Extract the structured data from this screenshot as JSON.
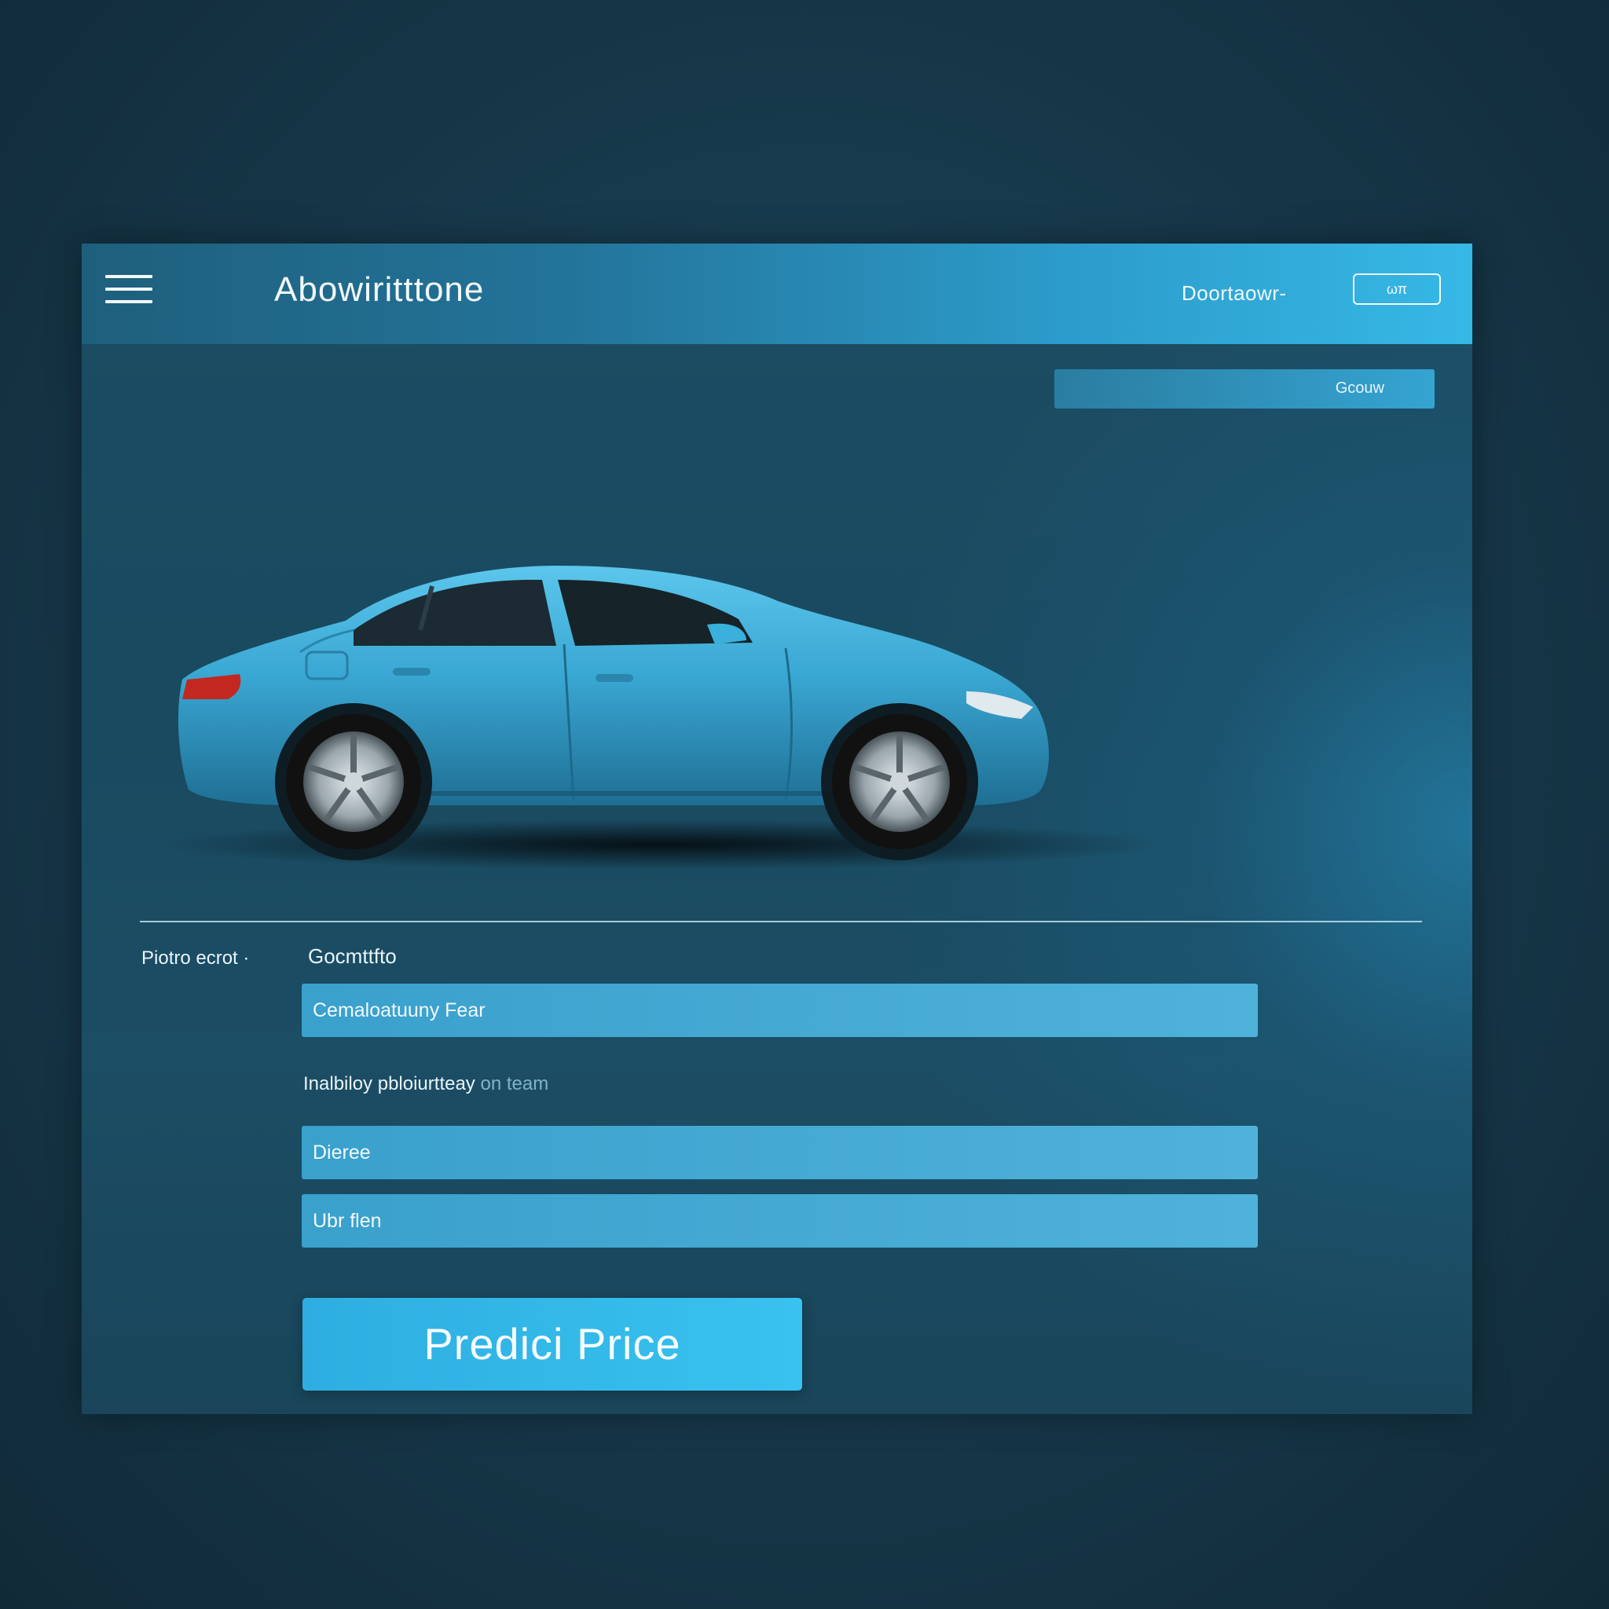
{
  "header": {
    "brand": "Abowiritttone",
    "nav_link": "Doortaowr-",
    "nav_button": "ωπ",
    "menu_icon": "hamburger-icon"
  },
  "search": {
    "label": "Gcouw"
  },
  "hero": {
    "image": "blue-sedan-car"
  },
  "form": {
    "side_label": "Piotro ecrot ·",
    "field1_label": "Gocmttfto",
    "field1_value": "Cemaloatuuny Fear",
    "field2_label": "Inalbiloy pbloiurtteay",
    "field2_label_muted": "on team",
    "field2_value": "Dieree",
    "field3_value": "Ubr flen",
    "submit_label": "Predici Price"
  },
  "colors": {
    "accent": "#36b8e6",
    "background": "#173a4c",
    "panel": "#1c4c63",
    "input": "#4fb2da",
    "car": "#3aaad3"
  }
}
